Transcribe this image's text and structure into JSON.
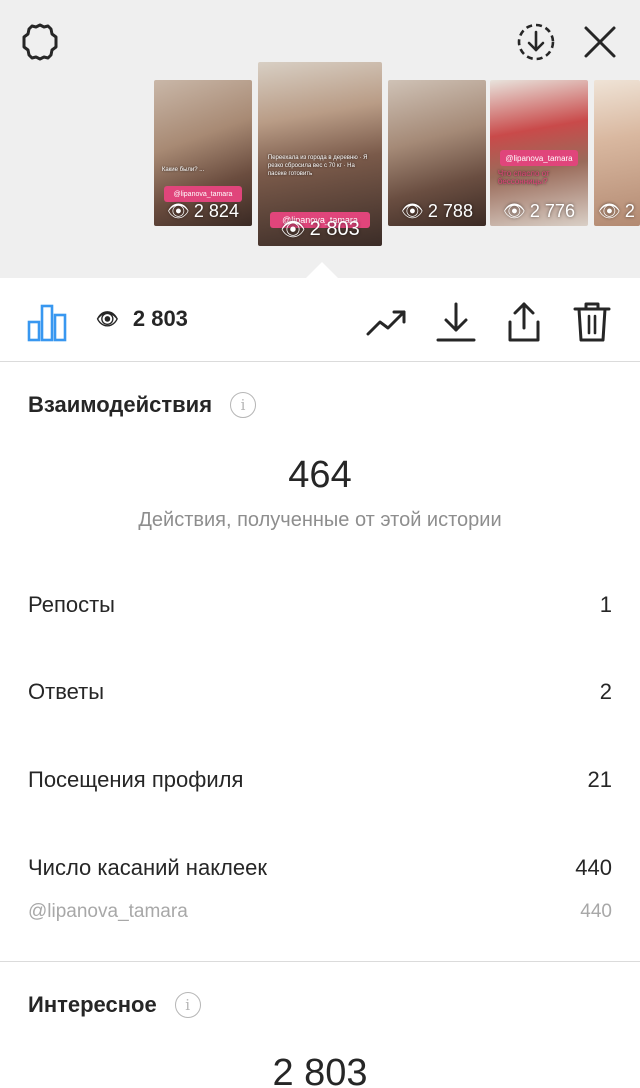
{
  "header": {
    "settings_icon": "gear-outline-icon",
    "download_icon": "download-circle-icon",
    "close_icon": "close-icon"
  },
  "thumbnails": [
    {
      "views": "2 824",
      "tag": "@lipanova_tamara",
      "caption": "Какие были? ...",
      "selected": false
    },
    {
      "views": "2 803",
      "tag": "@lipanova_tamara",
      "caption": "Переехала из города в деревню · Я резко сбросила вес с 70 кг · На пасеке готовить",
      "selected": true
    },
    {
      "views": "2 788",
      "tag": "",
      "caption": "",
      "selected": false
    },
    {
      "views": "2 776",
      "tag": "@lipanova_tamara",
      "caption": "Что спасло от бессонницы?",
      "selected": false
    },
    {
      "views": "2",
      "tag": "",
      "caption": "",
      "selected": false
    }
  ],
  "toolbar": {
    "views_count": "2 803",
    "chart_icon": "bar-chart-icon",
    "eye_icon": "eye-icon",
    "trend_icon": "trending-up-icon",
    "download_icon": "download-icon",
    "share_icon": "share-icon",
    "delete_icon": "trash-icon"
  },
  "interactions": {
    "title": "Взаимодействия",
    "total": "464",
    "caption": "Действия, полученные от этой истории",
    "rows": [
      {
        "label": "Репосты",
        "value": "1"
      },
      {
        "label": "Ответы",
        "value": "2"
      },
      {
        "label": "Посещения профиля",
        "value": "21"
      },
      {
        "label": "Число касаний наклеек",
        "value": "440"
      }
    ],
    "sub_row": {
      "label": "@lipanova_tamara",
      "value": "440"
    }
  },
  "discovery": {
    "title": "Интересное",
    "total": "2 803"
  },
  "colors": {
    "accent_blue": "#3897f0",
    "tag_pink": "#e0457b",
    "muted_text": "#8e8e8e",
    "top_bg": "#efefef"
  }
}
